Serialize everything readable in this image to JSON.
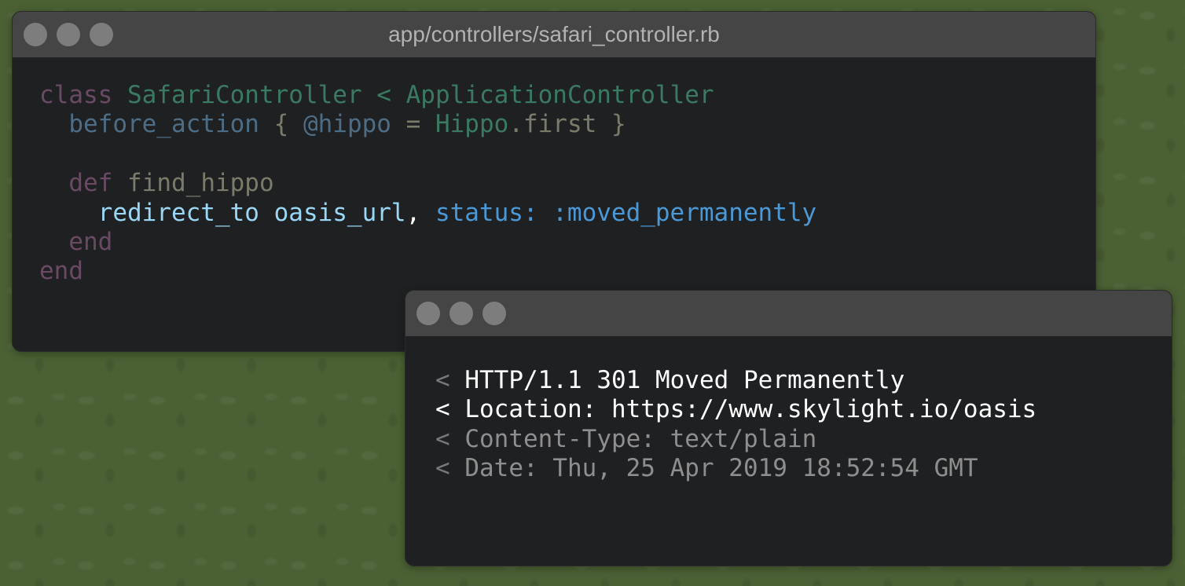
{
  "editor_window": {
    "title": "app/controllers/safari_controller.rb",
    "code": {
      "line1": {
        "kw": "class",
        "class_name": "SafariController",
        "op": "<",
        "parent": "ApplicationController"
      },
      "line2": {
        "method": "before_action",
        "open": "{",
        "ivar": "@hippo",
        "eq": "=",
        "model": "Hippo",
        "call": ".first",
        "close": "}"
      },
      "line3": {
        "kw": "def",
        "name": "find_hippo"
      },
      "line4": {
        "call": "redirect_to oasis_url",
        "comma": ",",
        "arg": "status: :moved_permanently"
      },
      "line5": {
        "kw": "end"
      },
      "line6": {
        "kw": "end"
      }
    }
  },
  "response_window": {
    "lines": [
      {
        "prompt": "<",
        "text": "HTTP/1.1 301 Moved Permanently"
      },
      {
        "prompt": "<",
        "text": "Location: https://www.skylight.io/oasis"
      },
      {
        "prompt": "<",
        "text": "Content-Type: text/plain"
      },
      {
        "prompt": "<",
        "text": "Date: Thu, 25 Apr 2019 18:52:54 GMT"
      }
    ]
  },
  "colors": {
    "background": "#4b6134",
    "window_bg": "#1f2022",
    "titlebar_bg": "#454545",
    "window_dot": "#7d7d7d"
  }
}
